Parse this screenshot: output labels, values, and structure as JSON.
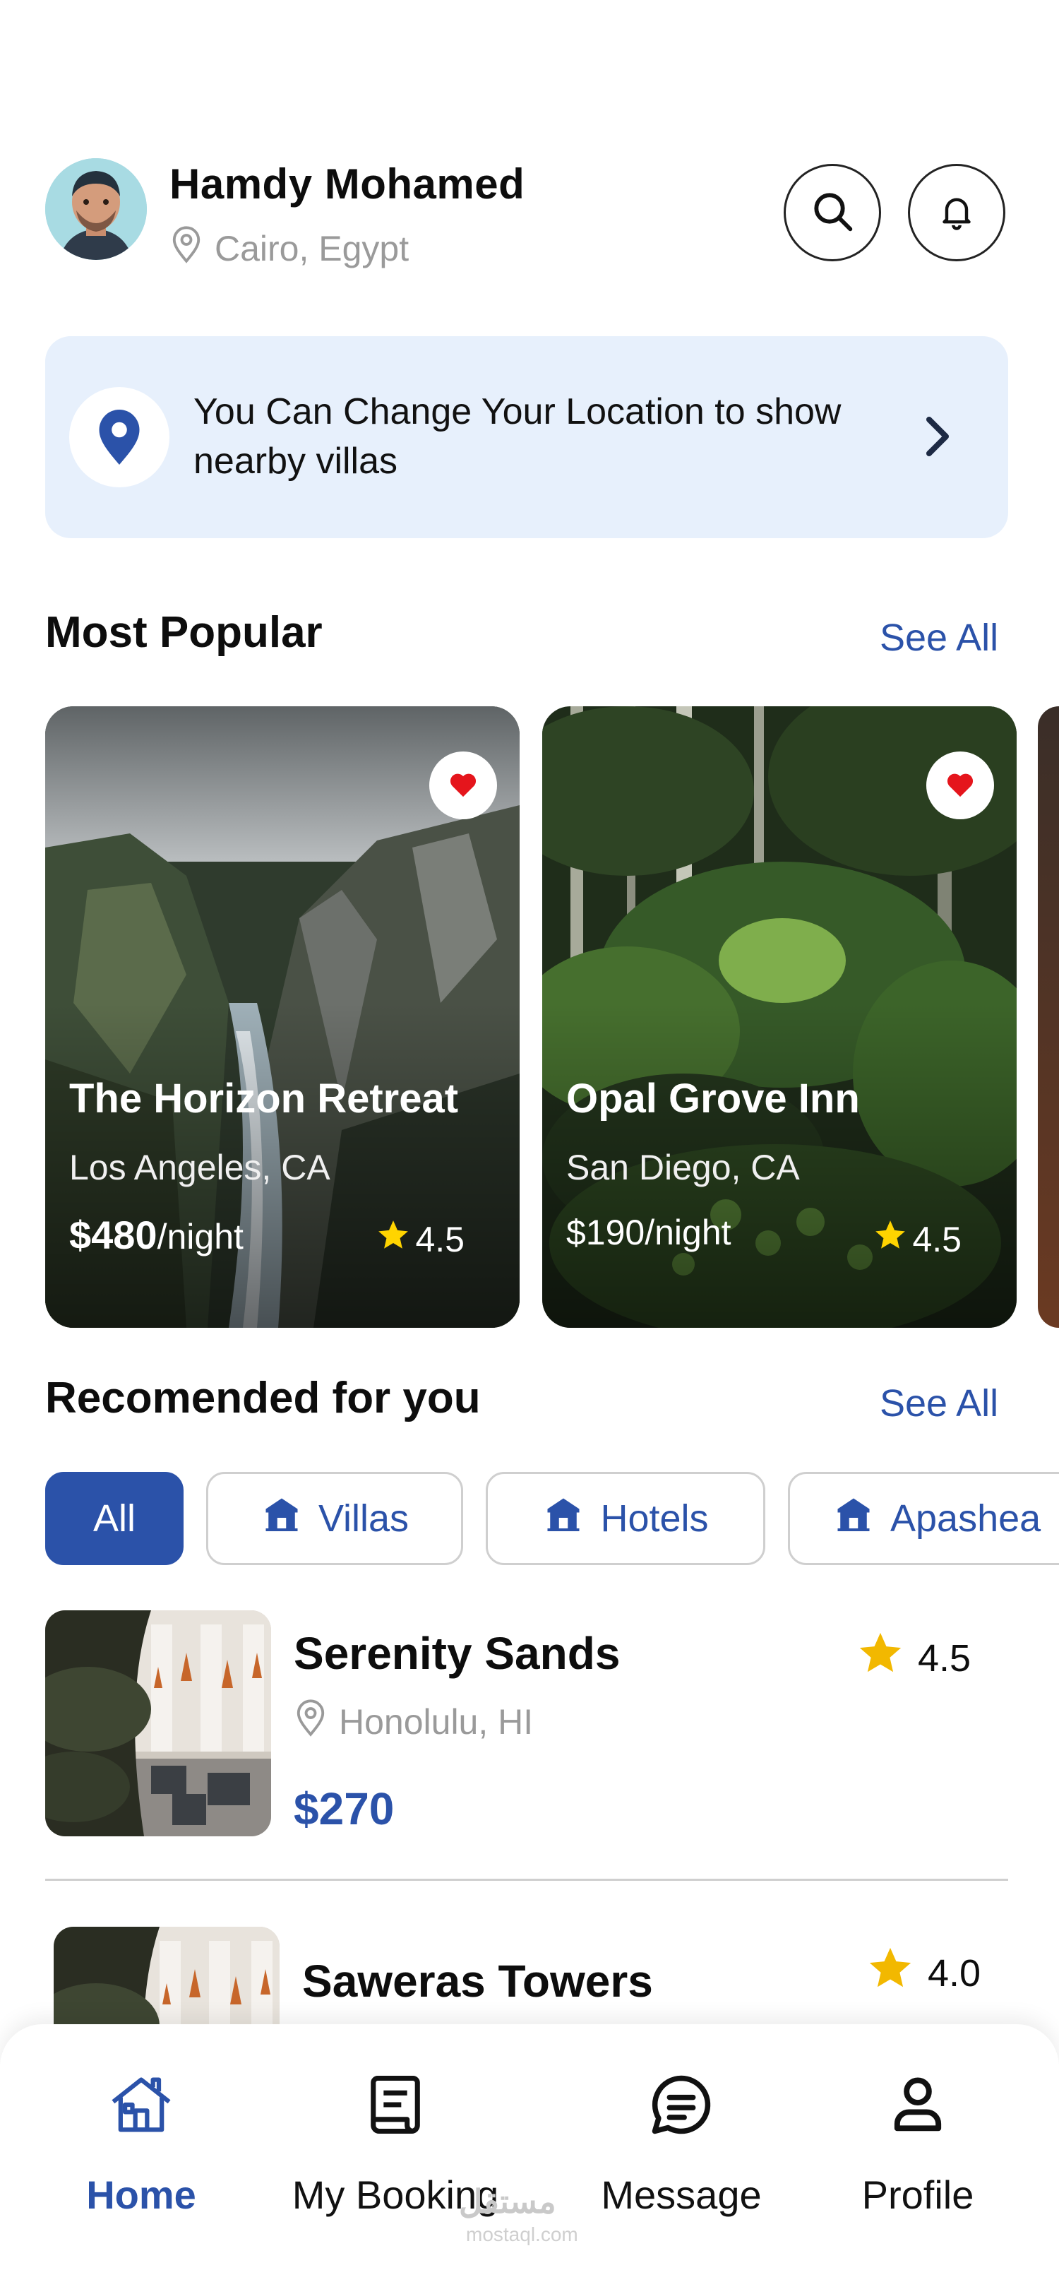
{
  "user": {
    "name": "Hamdy Mohamed",
    "location": "Cairo, Egypt"
  },
  "banner": {
    "text": "You Can Change Your Location to show nearby villas"
  },
  "popular": {
    "title": "Most Popular",
    "see_all": "See All",
    "cards": [
      {
        "name": "The Horizon Retreat",
        "location": "Los Angeles, CA",
        "price": "$480",
        "unit": "/night",
        "rating": "4.5"
      },
      {
        "name": "Opal Grove Inn",
        "location": "San Diego, CA",
        "price": "$190",
        "unit": "/night",
        "rating": "4.5"
      }
    ]
  },
  "recommended": {
    "title": "Recomended for you",
    "see_all": "See All",
    "filters": [
      "All",
      "Villas",
      "Hotels",
      "Apashea"
    ],
    "items": [
      {
        "name": "Serenity Sands",
        "location": "Honolulu, HI",
        "price": "$270",
        "rating": "4.5"
      },
      {
        "name": "Saweras Towers",
        "rating": "4.0"
      }
    ]
  },
  "nav": {
    "items": [
      "Home",
      "My Booking",
      "Message",
      "Profile"
    ],
    "active": "Home"
  },
  "watermark": {
    "text": "مستقل",
    "sub": "mostaql.com"
  },
  "colors": {
    "accent": "#2b52a9",
    "banner_bg": "#e7f0fc",
    "heart": "#e5151c",
    "star": "#f2b800"
  }
}
